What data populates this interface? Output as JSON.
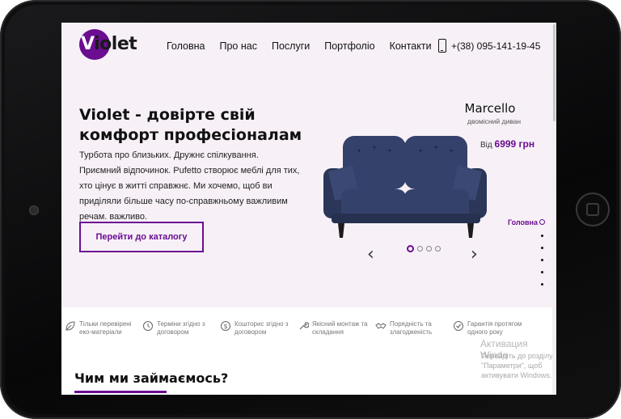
{
  "brand": {
    "logo_text": "Violet",
    "logo_letter": "V",
    "logo_rest": "iolet",
    "accent": "#6a0d91"
  },
  "nav": [
    {
      "label": "Головна"
    },
    {
      "label": "Про нас"
    },
    {
      "label": "Послуги"
    },
    {
      "label": "Портфоліо"
    },
    {
      "label": "Контакти"
    }
  ],
  "phone": {
    "number": "+(38) 095-141-19-45",
    "icon": "phone-icon"
  },
  "hero": {
    "title": "Violet - довірте свій комфорт професіоналам",
    "description": "Турбота про близьких. Дружнє спілкування. Приємний відпочинок. Pufetto створює меблі для тих, хто цінує в житті справжнє. Ми хочемо, щоб ви приділяли більше часу по-справжньому важливим речам. важливо.",
    "cta_label": "Перейти до каталогу"
  },
  "product": {
    "name": "Marcello",
    "subtitle": "двомісний диван",
    "price_prefix": "Від",
    "price_value": "6999 грн",
    "sofa_color": "#2e3a5e"
  },
  "slider": {
    "prev_icon": "‹",
    "next_icon": "›",
    "total": 4,
    "active": 1
  },
  "side_nav": {
    "active_label": "Головна",
    "count": 6
  },
  "features": [
    {
      "icon": "leaf-icon",
      "text": "Тільки перевірені еко-матеріали"
    },
    {
      "icon": "clock-icon",
      "text": "Терміни згідно з договором"
    },
    {
      "icon": "dollar-icon",
      "text": "Кошторис згідно з договором"
    },
    {
      "icon": "wrench-icon",
      "text": "Якісний монтаж та складання"
    },
    {
      "icon": "handshake-icon",
      "text": "Порядність та злагодженість"
    },
    {
      "icon": "check-badge-icon",
      "text": "Гарантія протягом одного року"
    }
  ],
  "watermark": {
    "title": "Активация Windo",
    "text": "Перейдіть до розділу \"Параметри\", щоб активувати Windows."
  },
  "section": {
    "title": "Чим ми займаємось?"
  }
}
